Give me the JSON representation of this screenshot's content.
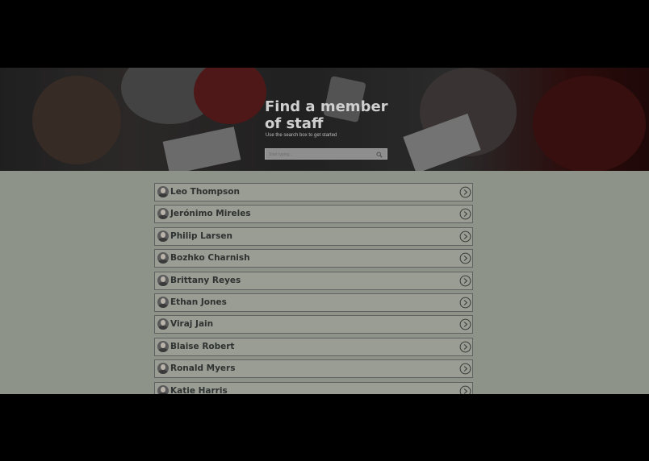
{
  "hero": {
    "title": "Find a member of staff",
    "subtitle": "Use the search box to get started",
    "search": {
      "placeholder": "Start typing...",
      "icon": "search-icon"
    }
  },
  "staff": [
    {
      "name": "Leo Thompson"
    },
    {
      "name": "Jerónimo Mireles"
    },
    {
      "name": "Philip Larsen"
    },
    {
      "name": "Bozhko Charnish"
    },
    {
      "name": "Brittany Reyes"
    },
    {
      "name": "Ethan Jones"
    },
    {
      "name": "Viraj Jain"
    },
    {
      "name": "Blaise Robert"
    },
    {
      "name": "Ronald Myers"
    },
    {
      "name": "Katie Harris"
    }
  ],
  "colors": {
    "page_bg": "#8e938a",
    "row_bg": "#999d94",
    "row_border": "#5e6160",
    "text": "#2e3230"
  }
}
